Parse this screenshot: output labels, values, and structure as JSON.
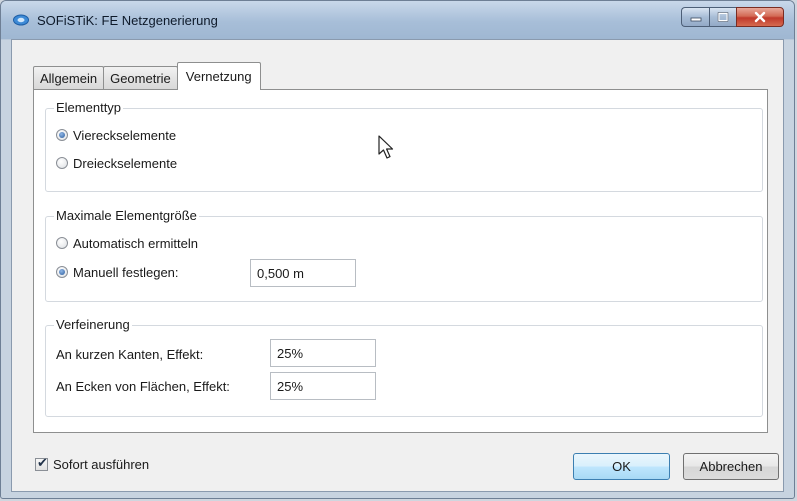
{
  "window": {
    "title": "SOFiSTiK: FE Netzgenerierung",
    "accent_color": "#a7bed8",
    "close_color": "#c0392b"
  },
  "tabs": [
    {
      "label": "Allgemein",
      "active": false
    },
    {
      "label": "Geometrie",
      "active": false
    },
    {
      "label": "Vernetzung",
      "active": true
    }
  ],
  "elementtyp": {
    "title": "Elementtyp",
    "options": [
      {
        "label": "Viereckselemente",
        "checked": true
      },
      {
        "label": "Dreieckselemente",
        "checked": false
      }
    ]
  },
  "max_size": {
    "title": "Maximale Elementgröße",
    "auto_label": "Automatisch ermitteln",
    "auto_checked": false,
    "manual_label": "Manuell festlegen:",
    "manual_checked": true,
    "value": "0,500 m"
  },
  "refinement": {
    "title": "Verfeinerung",
    "short_edges_label": "An kurzen Kanten, Effekt:",
    "short_edges_value": "25%",
    "corners_label": "An Ecken von Flächen, Effekt:",
    "corners_value": "25%"
  },
  "footer": {
    "execute_label": "Sofort ausführen",
    "execute_checked": true,
    "ok_label": "OK",
    "cancel_label": "Abbrechen"
  }
}
